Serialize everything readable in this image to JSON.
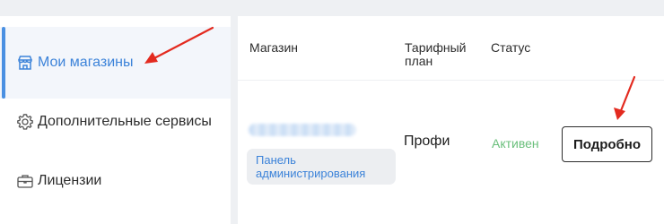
{
  "sidebar": {
    "items": [
      {
        "label": "Мои магазины",
        "icon": "store-icon",
        "active": true
      },
      {
        "label": "Дополнительные сервисы",
        "icon": "gear-icon",
        "active": false
      },
      {
        "label": "Лицензии",
        "icon": "briefcase-icon",
        "active": false
      }
    ]
  },
  "table": {
    "headers": {
      "store": "Магазин",
      "plan": "Тарифный план",
      "status": "Статус"
    },
    "rows": [
      {
        "admin_link": "Панель администрирования",
        "plan": "Профи",
        "status": "Активен",
        "details_label": "Подробно"
      }
    ]
  },
  "colors": {
    "accent": "#3c83d9",
    "status_active": "#6abf7b",
    "arrow": "#e32a1f"
  }
}
